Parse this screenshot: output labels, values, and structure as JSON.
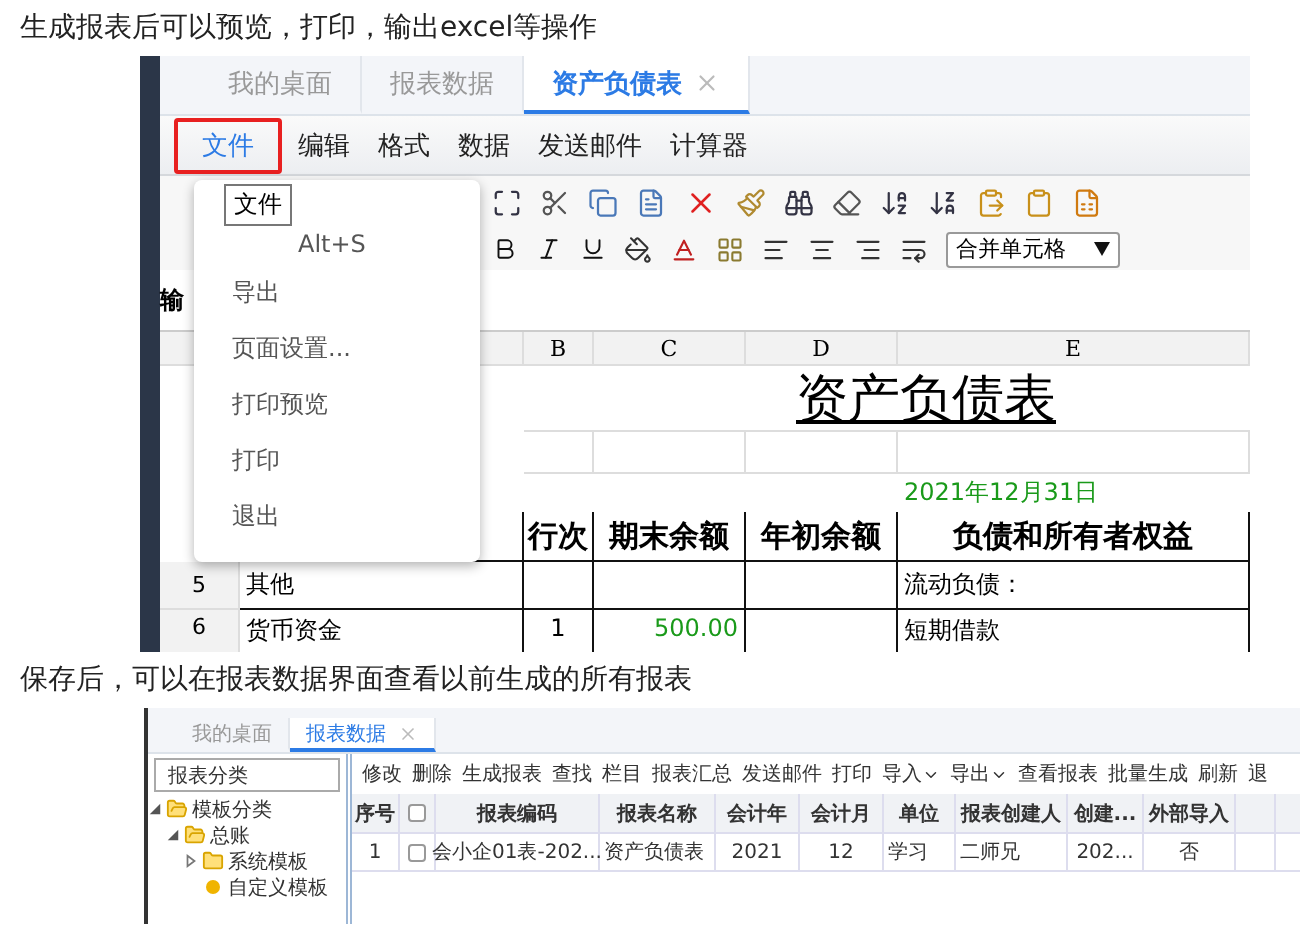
{
  "caption_top": "生成报表后可以预览，打印，输出excel等操作",
  "screenshot_1": {
    "tabs": [
      {
        "label": "我的桌面",
        "selected": false,
        "closable": false
      },
      {
        "label": "报表数据",
        "selected": false,
        "closable": false
      },
      {
        "label": "资产负债表",
        "selected": true,
        "closable": true
      }
    ],
    "menu_bar": [
      {
        "label": "文件",
        "highlighted": true
      },
      {
        "label": "编辑",
        "highlighted": false
      },
      {
        "label": "格式",
        "highlighted": false
      },
      {
        "label": "数据",
        "highlighted": false
      },
      {
        "label": "发送邮件",
        "highlighted": false
      },
      {
        "label": "计算器",
        "highlighted": false
      }
    ],
    "merge_dropdown": "合并单元格",
    "formula_label": "输",
    "file_menu": {
      "tooltip": "文件",
      "items": [
        {
          "label": "Alt+S"
        },
        {
          "label": "导出"
        },
        {
          "label": "页面设置..."
        },
        {
          "label": "打印预览"
        },
        {
          "label": "打印"
        },
        {
          "label": "退出"
        }
      ]
    },
    "sheet": {
      "column_headers": [
        "B",
        "C",
        "D",
        "E"
      ],
      "title": "资产负债表",
      "date": "2021年12月31日",
      "header_row": {
        "B": "行次",
        "C": "期末余额",
        "D": "年初余额",
        "E": "负债和所有者权益"
      },
      "rows": [
        {
          "number": "5",
          "cells": {
            "A": "其他",
            "E": "流动负债："
          }
        },
        {
          "number": "6",
          "cells": {
            "A": "货币资金",
            "B": "1",
            "C": "500.00",
            "E": "短期借款"
          }
        }
      ]
    }
  },
  "caption_bottom": "保存后，可以在报表数据界面查看以前生成的所有报表",
  "screenshot_2": {
    "tabs": [
      {
        "label": "我的桌面",
        "selected": false,
        "closable": false
      },
      {
        "label": "报表数据",
        "selected": true,
        "closable": true
      }
    ],
    "category_field": "报表分类",
    "tree": [
      {
        "label": "模板分类",
        "kind": "folder",
        "expanded": true,
        "children": [
          {
            "label": "总账",
            "kind": "folder",
            "expanded": true,
            "children": [
              {
                "label": "系统模板",
                "kind": "folder",
                "expanded": false
              },
              {
                "label": "自定义模板",
                "kind": "leaf"
              }
            ]
          }
        ]
      }
    ],
    "toolbar": [
      {
        "label": "修改",
        "has_menu": false
      },
      {
        "label": "删除",
        "has_menu": false
      },
      {
        "label": "生成报表",
        "has_menu": false
      },
      {
        "label": "查找",
        "has_menu": false
      },
      {
        "label": "栏目",
        "has_menu": false
      },
      {
        "label": "报表汇总",
        "has_menu": false
      },
      {
        "label": "发送邮件",
        "has_menu": false
      },
      {
        "label": "打印",
        "has_menu": false
      },
      {
        "label": "导入",
        "has_menu": true
      },
      {
        "label": "导出",
        "has_menu": true
      },
      {
        "label": "查看报表",
        "has_menu": false
      },
      {
        "label": "批量生成",
        "has_menu": false
      },
      {
        "label": "刷新",
        "has_menu": false
      },
      {
        "label": "退",
        "has_menu": false
      }
    ],
    "table": {
      "columns": [
        "序号",
        "报表编码",
        "报表名称",
        "会计年",
        "会计月",
        "单位",
        "报表创建人",
        "创建...",
        "外部导入"
      ],
      "header_checked": false,
      "rows": [
        {
          "checked": false,
          "cells": [
            "1",
            "会小企01表-202...",
            "资产负债表",
            "2021",
            "12",
            "学习",
            "二师兄",
            "202...",
            "否"
          ]
        }
      ]
    }
  }
}
